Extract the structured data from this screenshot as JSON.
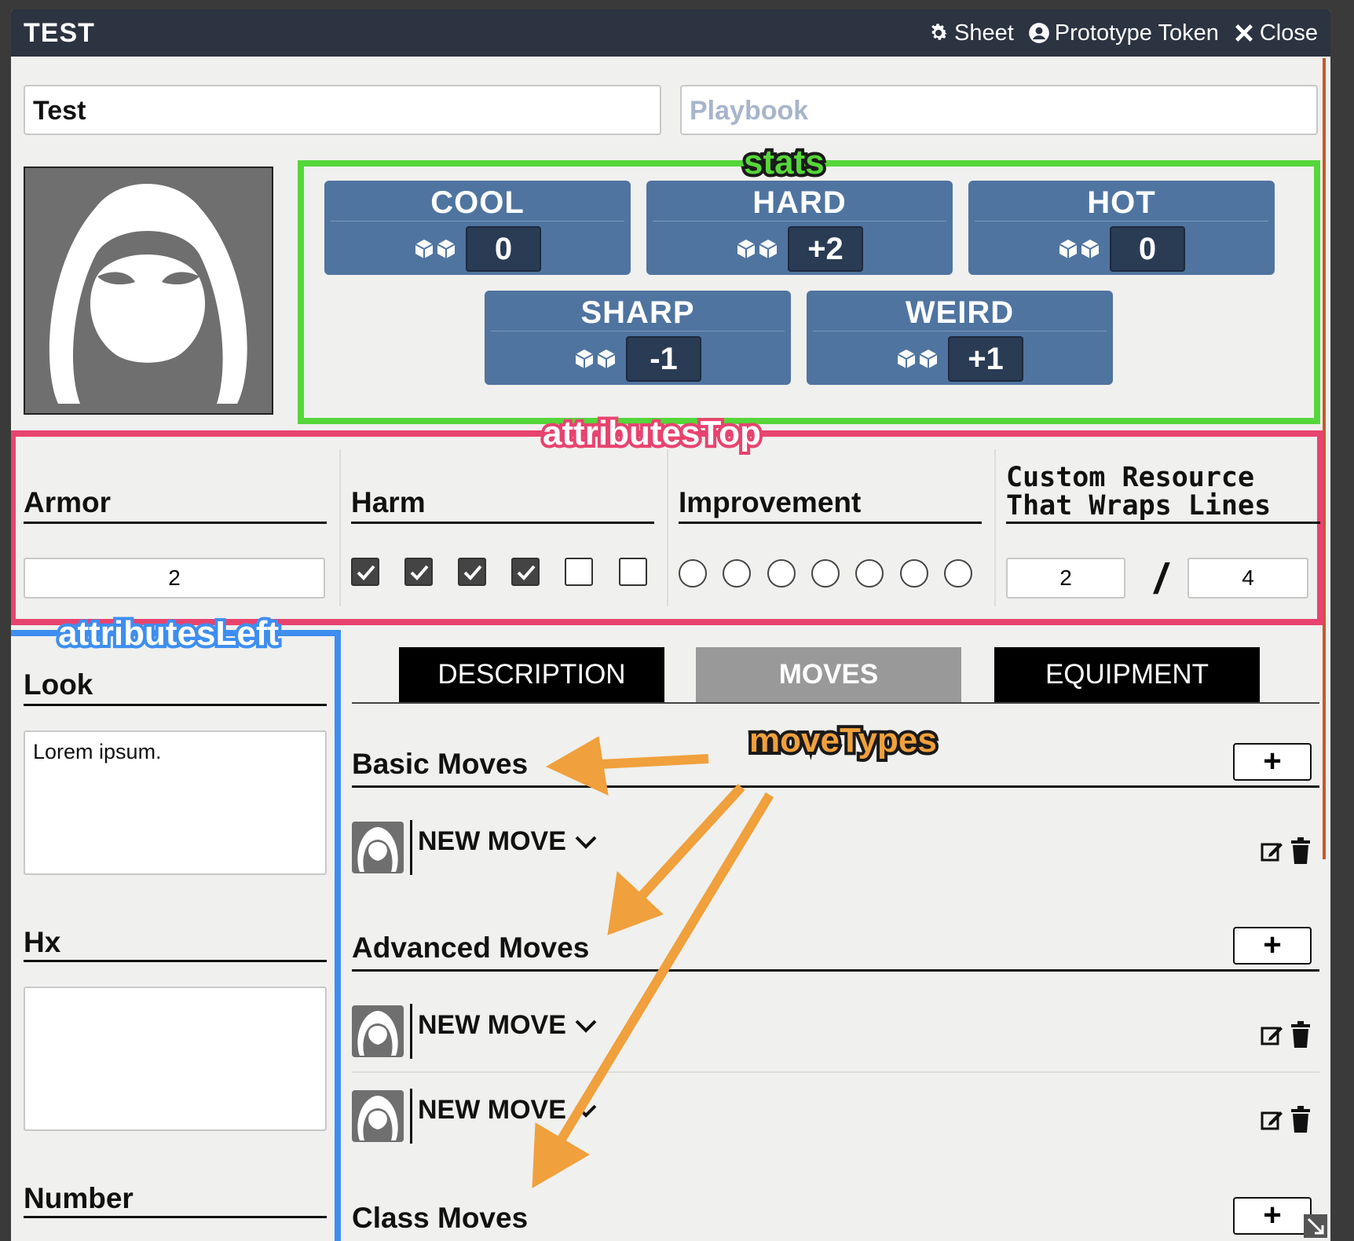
{
  "window": {
    "title": "TEST",
    "header_buttons": [
      {
        "label": "Sheet",
        "icon": "gear-icon"
      },
      {
        "label": "Prototype Token",
        "icon": "user-circle-icon"
      },
      {
        "label": "Close",
        "icon": "close-icon"
      }
    ]
  },
  "character": {
    "name_value": "Test",
    "playbook_placeholder": "Playbook"
  },
  "annotations": {
    "stats": "stats",
    "attributes_top": "attributesTop",
    "attributes_left": "attributesLeft",
    "move_types": "moveTypes",
    "colors": {
      "stats": "#55d63a",
      "attributes_top": "#e8436e",
      "attributes_left": "#3d8ef0",
      "move_types": "#f0a03c"
    }
  },
  "stats": [
    {
      "name": "COOL",
      "value": "0"
    },
    {
      "name": "HARD",
      "value": "+2"
    },
    {
      "name": "HOT",
      "value": "0"
    },
    {
      "name": "SHARP",
      "value": "-1"
    },
    {
      "name": "WEIRD",
      "value": "+1"
    }
  ],
  "attributes_top": {
    "armor": {
      "label": "Armor",
      "value": "2"
    },
    "harm": {
      "label": "Harm",
      "checked": [
        true,
        true,
        true,
        true,
        false,
        false
      ]
    },
    "improvement": {
      "label": "Improvement",
      "filled": [
        false,
        false,
        false,
        false,
        false,
        false,
        false
      ]
    },
    "custom": {
      "label_line1": "Custom Resource",
      "label_line2": "That Wraps Lines",
      "value": "2",
      "separator": "/",
      "max": "4"
    }
  },
  "attributes_left": {
    "look": {
      "label": "Look",
      "value": "Lorem ipsum."
    },
    "hx": {
      "label": "Hx",
      "value": ""
    },
    "number": {
      "label": "Number"
    }
  },
  "tabs": [
    {
      "label": "DESCRIPTION",
      "active": false
    },
    {
      "label": "MOVES",
      "active": true
    },
    {
      "label": "EQUIPMENT",
      "active": false
    }
  ],
  "moves": {
    "basic": {
      "label": "Basic Moves",
      "add": "+",
      "items": [
        {
          "name": "NEW MOVE"
        }
      ]
    },
    "advanced": {
      "label": "Advanced Moves",
      "add": "+",
      "items": [
        {
          "name": "NEW MOVE"
        },
        {
          "name": "NEW MOVE"
        }
      ]
    },
    "class": {
      "label": "Class Moves",
      "add": "+"
    }
  }
}
